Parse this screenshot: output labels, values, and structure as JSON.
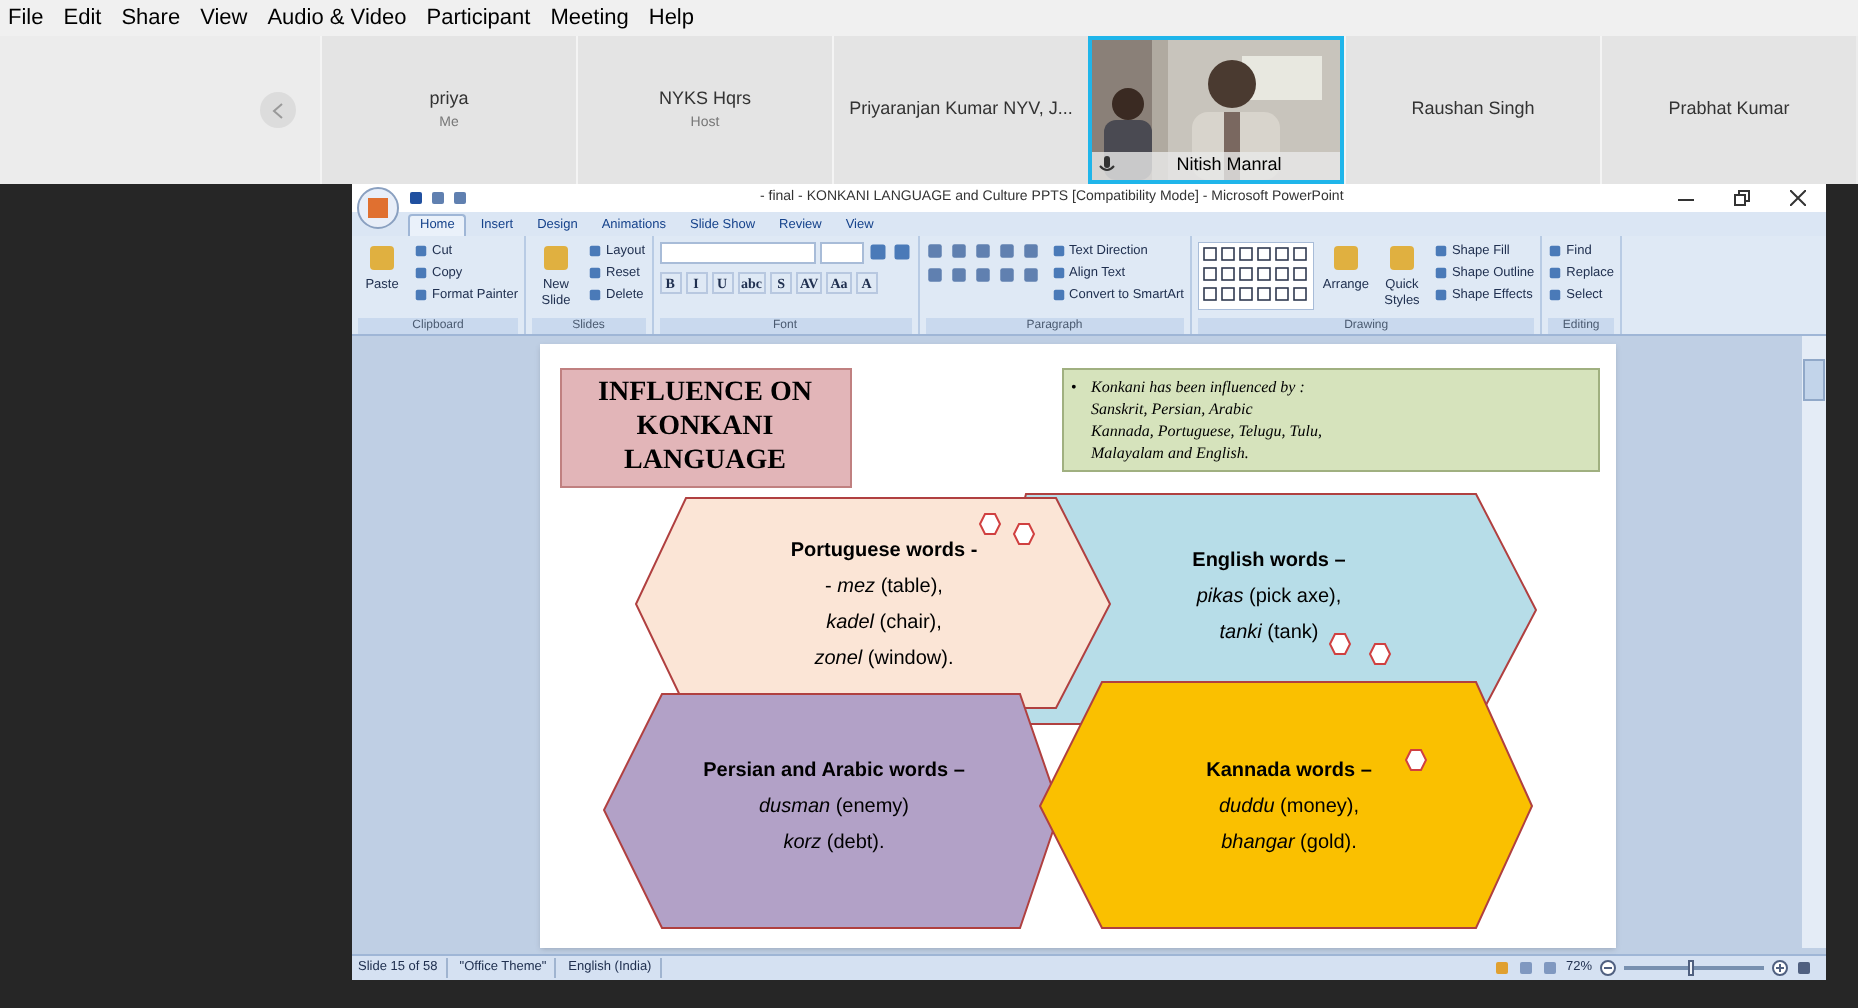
{
  "menu": [
    "File",
    "Edit",
    "Share",
    "View",
    "Audio & Video",
    "Participant",
    "Meeting",
    "Help"
  ],
  "participants": [
    {
      "kind": "tile",
      "name": "priya",
      "role": "Me"
    },
    {
      "kind": "tile",
      "name": "NYKS Hqrs",
      "role": "Host"
    },
    {
      "kind": "tile",
      "name": "Priyaranjan Kumar NYV, J..."
    },
    {
      "kind": "video",
      "name": "Nitish Manral"
    },
    {
      "kind": "tile",
      "name": "Raushan Singh"
    },
    {
      "kind": "tile",
      "name": "Prabhat Kumar"
    }
  ],
  "ppt": {
    "title": "- final - KONKANI LANGUAGE and Culture PPTS [Compatibility Mode] - Microsoft PowerPoint",
    "tabs": [
      {
        "label": "Home",
        "selected": true
      },
      {
        "label": "Insert",
        "selected": false
      },
      {
        "label": "Design",
        "selected": false
      },
      {
        "label": "Animations",
        "selected": false
      },
      {
        "label": "Slide Show",
        "selected": false
      },
      {
        "label": "Review",
        "selected": false
      },
      {
        "label": "View",
        "selected": false
      }
    ],
    "groups": [
      {
        "kind": "basic",
        "label": "Clipboard",
        "large": [
          "Paste"
        ],
        "small": [
          "Cut",
          "Copy",
          "Format Painter"
        ]
      },
      {
        "kind": "basic",
        "label": "Slides",
        "large": [
          "New Slide"
        ],
        "small": [
          "Layout",
          "Reset",
          "Delete"
        ]
      },
      {
        "kind": "font",
        "label": "Font",
        "buttons": [
          "B",
          "I",
          "U",
          "abc",
          "S",
          "AV",
          "Aa",
          "A"
        ]
      },
      {
        "kind": "paragraph",
        "label": "Paragraph",
        "small": [
          "Text Direction",
          "Align Text",
          "Convert to SmartArt"
        ]
      },
      {
        "kind": "drawing",
        "label": "Drawing",
        "large": [
          "Arrange",
          "Quick Styles"
        ],
        "small": [
          "Shape Fill",
          "Shape Outline",
          "Shape Effects"
        ]
      },
      {
        "kind": "basic",
        "label": "Editing",
        "small": [
          "Find",
          "Replace",
          "Select"
        ]
      }
    ],
    "slide": {
      "title_lines": [
        "INFLUENCE ON",
        "KONKANI",
        "LANGUAGE"
      ],
      "note_bullet": "•",
      "note_lines": [
        "Konkani has been influenced by :",
        "Sanskrit, Persian, Arabic",
        "Kannada, Portuguese, Telugu, Tulu,",
        "Malayalam and English."
      ],
      "hexagons": [
        {
          "color": "#fbe5d6",
          "heading": "Portuguese words -",
          "lines": [
            "- *mez* (table),",
            "*kadel* (chair),",
            "*zonel* (window)."
          ]
        },
        {
          "color": "#b7dde8",
          "heading": "English words –",
          "lines": [
            "*pikas* (pick axe),",
            "*tanki* (tank)"
          ]
        },
        {
          "color": "#b2a1c7",
          "heading": "Persian and Arabic words –",
          "lines": [
            "*dusman* (enemy)",
            "*korz* (debt)."
          ]
        },
        {
          "color": "#fac000",
          "heading": "Kannada words –",
          "lines": [
            "*duddu* (money),",
            "*bhangar* (gold)."
          ]
        }
      ]
    },
    "status": {
      "items": [
        "Slide 15 of 58",
        "\"Office Theme\"",
        "English (India)"
      ],
      "zoom": {
        "reading": "72%",
        "level": 0.45
      }
    }
  }
}
